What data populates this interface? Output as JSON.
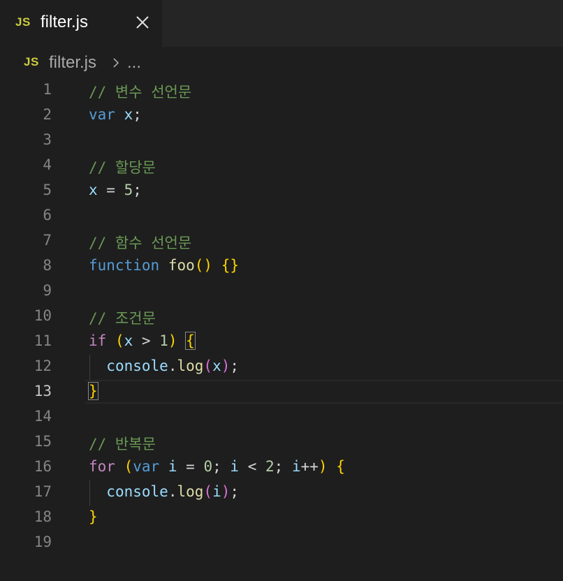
{
  "tab": {
    "badge": "JS",
    "label": "filter.js"
  },
  "breadcrumb": {
    "badge": "JS",
    "file": "filter.js",
    "more": "..."
  },
  "editor": {
    "active_line": 13,
    "lines": [
      {
        "num": "1"
      },
      {
        "num": "2"
      },
      {
        "num": "3"
      },
      {
        "num": "4"
      },
      {
        "num": "5"
      },
      {
        "num": "6"
      },
      {
        "num": "7"
      },
      {
        "num": "8"
      },
      {
        "num": "9"
      },
      {
        "num": "10"
      },
      {
        "num": "11"
      },
      {
        "num": "12"
      },
      {
        "num": "13"
      },
      {
        "num": "14"
      },
      {
        "num": "15"
      },
      {
        "num": "16"
      },
      {
        "num": "17"
      },
      {
        "num": "18"
      },
      {
        "num": "19"
      }
    ],
    "code": {
      "l1": "// 변수 선언문",
      "l2_kw": "var",
      "l2_var": "x",
      "l2_end": ";",
      "l4": "// 할당문",
      "l5_var": "x",
      "l5_op": " = ",
      "l5_num": "5",
      "l5_end": ";",
      "l7": "// 함수 선언문",
      "l8_kw": "function",
      "l8_fn": "foo",
      "l8_paren": "()",
      "l8_braces": "{}",
      "l10": "// 조건문",
      "l11_kw": "if",
      "l11_open": "(",
      "l11_var": "x",
      "l11_op": " > ",
      "l11_num": "1",
      "l11_close": ")",
      "l11_brace": "{",
      "l12_obj": "console",
      "l12_dot": ".",
      "l12_fn": "log",
      "l12_open": "(",
      "l12_var": "x",
      "l12_close": ")",
      "l12_end": ";",
      "l13_brace": "}",
      "l15": "// 반복문",
      "l16_kw": "for",
      "l16_open": "(",
      "l16_var_kw": "var",
      "l16_i1": "i",
      "l16_eq": " = ",
      "l16_n0": "0",
      "l16_semi1": "; ",
      "l16_i2": "i",
      "l16_lt": " < ",
      "l16_n2": "2",
      "l16_semi2": "; ",
      "l16_i3": "i",
      "l16_inc": "++",
      "l16_close": ")",
      "l16_brace": "{",
      "l17_obj": "console",
      "l17_dot": ".",
      "l17_fn": "log",
      "l17_open": "(",
      "l17_var": "i",
      "l17_close": ")",
      "l17_end": ";",
      "l18_brace": "}"
    }
  },
  "colors": {
    "background": "#1e1e1e",
    "comment": "#6a9955",
    "keyword": "#569cd6",
    "control": "#c586c0",
    "variable": "#9cdcfe",
    "number": "#b5cea8",
    "function": "#dcdcaa",
    "bracket_level1": "#ffd700",
    "bracket_level2": "#da70d6",
    "js_badge": "#cbcb41"
  },
  "icons": {
    "tab_close": "close-icon",
    "breadcrumb_separator": "chevron-right-icon"
  }
}
